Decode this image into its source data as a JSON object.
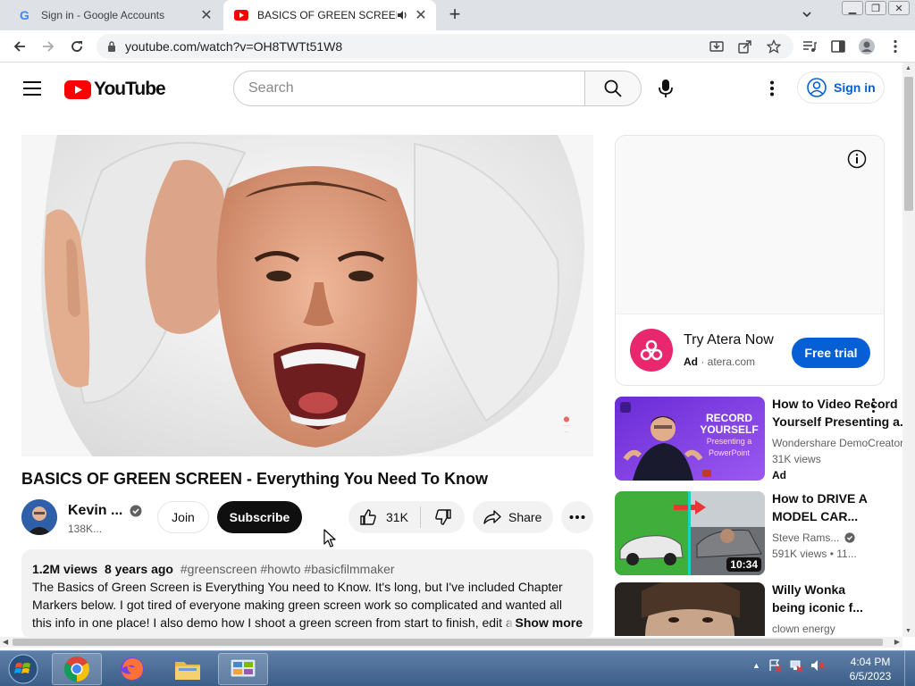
{
  "browser": {
    "tabs": [
      {
        "title": "Sign in - Google Accounts",
        "active": false
      },
      {
        "title": "BASICS OF GREEN SCREEN -",
        "active": true
      }
    ],
    "url": "youtube.com/watch?v=OH8TWTt51W8"
  },
  "header": {
    "logo_text": "YouTube",
    "search_placeholder": "Search",
    "signin_label": "Sign in"
  },
  "video": {
    "title": "BASICS OF GREEN SCREEN - Everything You Need To Know",
    "channel_name": "Kevin ...",
    "subscribers": "138K...",
    "join_label": "Join",
    "subscribe_label": "Subscribe",
    "likes": "31K",
    "share_label": "Share"
  },
  "description": {
    "views": "1.2M views",
    "age": "8 years ago",
    "tags": "#greenscreen #howto #basicfilmmaker",
    "line1": "The Basics of Green Screen is Everything You need to Know. It's long, but I've included Chapter",
    "line2": "Markers below. I got tired of everyone making green screen work so complicated and wanted all",
    "line3": "this info in one place!  I also demo how I shoot a green screen from start to finish, edit a",
    "show_more": "Show more"
  },
  "ad": {
    "title": "Try Atera Now",
    "label": "Ad",
    "domain": "atera.com",
    "cta": "Free trial"
  },
  "recommendations": [
    {
      "title1": "How to Video Record",
      "title2": "Yourself Presenting a...",
      "channel": "Wondershare DemoCreator",
      "meta": "31K views",
      "ad_tag": "Ad",
      "thumb_text": [
        "RECORD",
        "YOURSELF",
        "Presenting a",
        "PowerPoint"
      ]
    },
    {
      "title1": "How to DRIVE A",
      "title2": "MODEL CAR...",
      "channel": "Steve Rams...",
      "meta": "591K views  •  11...",
      "duration": "10:34"
    },
    {
      "title1": "Willy Wonka",
      "title2": "being iconic f...",
      "channel": "clown energy"
    }
  ],
  "taskbar": {
    "time": "4:04 PM",
    "date": "6/5/2023"
  },
  "colors": {
    "youtube_red": "#ff0000",
    "link_blue": "#065fd4",
    "subscribe_black": "#0f0f0f",
    "atera_pink": "#e8276f"
  },
  "icons": [
    "google-g-icon",
    "youtube-favicon-icon",
    "audio-playing-icon",
    "close-icon",
    "plus-icon",
    "chevron-down-icon",
    "back-arrow-icon",
    "forward-arrow-icon",
    "reload-icon",
    "lock-icon",
    "install-icon",
    "share-page-icon",
    "star-icon",
    "media-icon",
    "sidepanel-icon",
    "profile-icon",
    "kebab-icon",
    "hamburger-icon",
    "search-icon",
    "mic-icon",
    "account-icon",
    "verified-icon",
    "thumbs-up-icon",
    "thumbs-down-icon",
    "share-arrow-icon",
    "more-horiz-icon",
    "info-icon"
  ]
}
